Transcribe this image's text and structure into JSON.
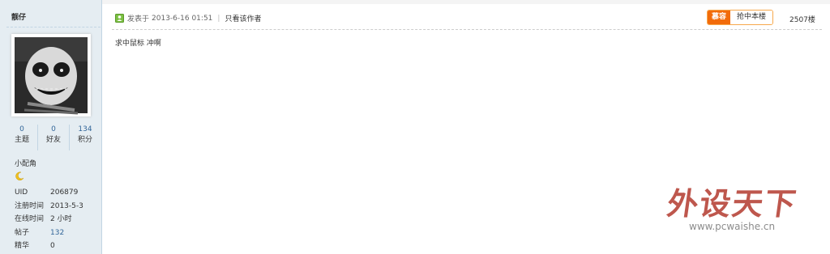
{
  "user": {
    "name": "靓仔",
    "stats": [
      {
        "value": "0",
        "label": "主题"
      },
      {
        "value": "0",
        "label": "好友"
      },
      {
        "value": "134",
        "label": "积分"
      }
    ],
    "group": "小配角",
    "icon": "moon-icon",
    "info": [
      {
        "key": "UID",
        "value": "206879"
      },
      {
        "key": "注册时间",
        "value": "2013-5-3"
      },
      {
        "key": "在线时间",
        "value": "2 小时"
      },
      {
        "key": "帖子",
        "value": "132"
      },
      {
        "key": "精华",
        "value": "0"
      }
    ]
  },
  "post": {
    "posted_prefix": "发表于",
    "posted_time": "2013-6-16 01:51",
    "separator": "|",
    "author_only": "只看该作者",
    "rush_tag": "慕容",
    "rush_label": "抢中本楼",
    "floor": "2507楼",
    "content": "求中鼠标 冲啊"
  },
  "watermark": {
    "title": "外设天下",
    "url": "www.pcwaishe.cn"
  },
  "colors": {
    "sidebar_bg": "#e5edf2",
    "link": "#336699",
    "rush_orange": "#f26b0a",
    "watermark_red": "#b33a2e"
  }
}
